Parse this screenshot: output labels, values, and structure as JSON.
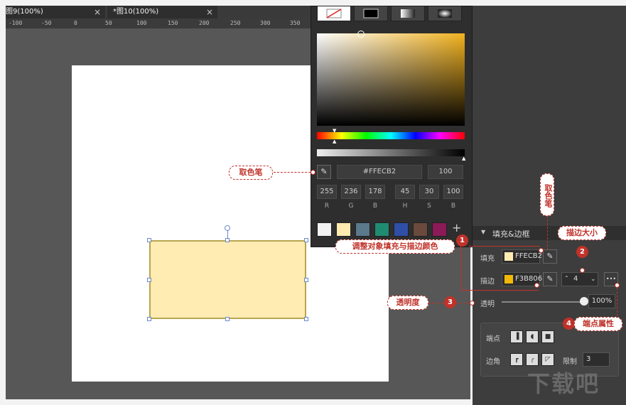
{
  "tabs": [
    {
      "label": "图9(100%)"
    },
    {
      "label": "*图10(100%)"
    }
  ],
  "tab_close": "×",
  "ruler": [
    "-100",
    "-50",
    "0",
    "50",
    "100",
    "150",
    "200",
    "250",
    "300",
    "350"
  ],
  "picker": {
    "hex": "#FFECB2",
    "alpha": "100",
    "channels": [
      {
        "value": "255",
        "label": "R"
      },
      {
        "value": "236",
        "label": "G"
      },
      {
        "value": "178",
        "label": "B"
      },
      {
        "value": "45",
        "label": "H"
      },
      {
        "value": "30",
        "label": "S"
      },
      {
        "value": "100",
        "label": "B"
      }
    ],
    "swatches": [
      "#f2f2f2",
      "#ffeab0",
      "#5b7a8c",
      "#1f8c72",
      "#2f4ea6",
      "#6b4a3e",
      "#8c1a56"
    ],
    "add_label": "+"
  },
  "panel": {
    "section_title": "填充&边框",
    "fill_label": "填充",
    "fill_value": "FFECB2",
    "fill_color": "#FFECB2",
    "stroke_label": "描边",
    "stroke_value": "F3B806",
    "stroke_color": "#F3B806",
    "stroke_size": "4",
    "opacity_label": "透明",
    "opacity_value": "100%",
    "opacity": 1.0,
    "endpoint_label": "端点",
    "corner_label": "边角",
    "limit_label": "限制",
    "limit_value": "3",
    "more_label": "•••"
  },
  "annotations": {
    "eyedropper_left": "取色笔",
    "eyedropper_top": "取色笔",
    "stroke_size": "描边大小",
    "adjust": "调整对象填充与描边颜色",
    "opacity": "透明度",
    "endpoint": "端点属性",
    "n1": "1",
    "n2": "2",
    "n3": "3",
    "n4": "4"
  },
  "watermark": "下载吧",
  "colors": {
    "accent": "#c0322a",
    "shape_fill": "#feecb2",
    "shape_border": "#b8a650"
  }
}
